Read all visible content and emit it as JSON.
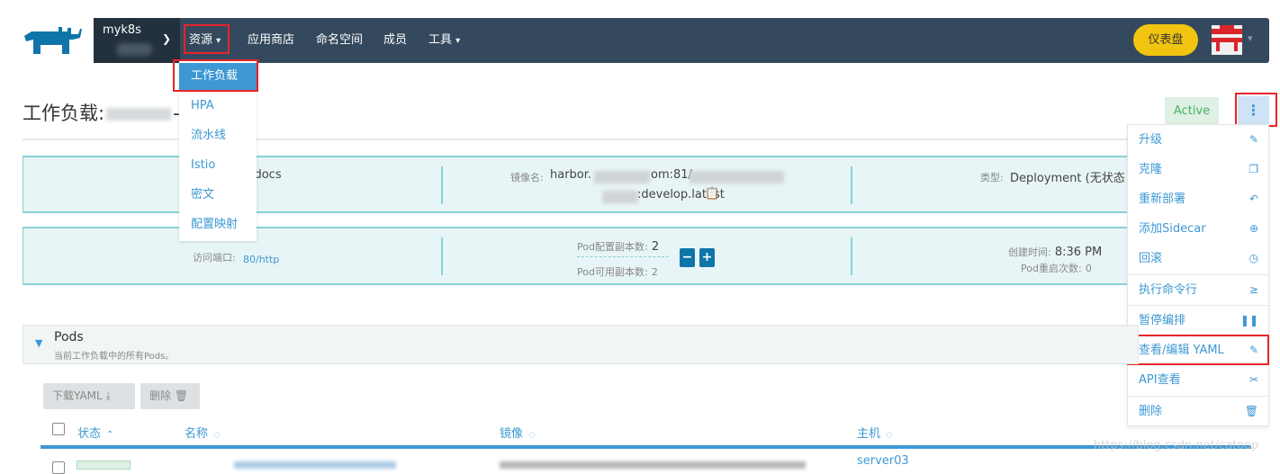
{
  "nav": {
    "cluster": "myk8s",
    "items": [
      {
        "label": "资源",
        "has_chevron": true
      },
      {
        "label": "应用商店"
      },
      {
        "label": "命名空间"
      },
      {
        "label": "成员"
      },
      {
        "label": "工具",
        "has_chevron": true
      }
    ],
    "dashboard_button": "仪表盘"
  },
  "resource_menu": [
    "工作负载",
    "HPA",
    "流水线",
    "Istio",
    "密文",
    "配置映射"
  ],
  "page": {
    "title": "工作负载:",
    "title_suffix": "-d",
    "status": "Active"
  },
  "info1": {
    "name_value": "s-docs",
    "image_label": "镜像名:",
    "image_line1a": "harbor.",
    "image_line1b": "om:81/",
    "image_line2": ":develop.latest",
    "type_label": "类型:",
    "type_value": "Deployment (无状态"
  },
  "info2": {
    "port_label": "访问端口:",
    "port_value": "80/http",
    "config_replicas_label": "Pod配置副本数:",
    "config_replicas": "2",
    "available_replicas_label": "Pod可用副本数:",
    "available_replicas": "2",
    "created_label": "创建时间:",
    "created_value": "8:36 PM",
    "restarts_label": "Pod重启次数:",
    "restarts": "0"
  },
  "actions_menu": [
    {
      "label": "升级",
      "icon": "pencil-icon",
      "glyph": "✎"
    },
    {
      "label": "克隆",
      "icon": "clone-icon",
      "glyph": "❐"
    },
    {
      "label": "重新部署",
      "icon": "redeploy-icon",
      "glyph": "↶"
    },
    {
      "label": "添加Sidecar",
      "icon": "plus-circle-icon",
      "glyph": "⊕"
    },
    {
      "label": "回滚",
      "icon": "history-icon",
      "glyph": "◷"
    },
    {
      "label": "执行命令行",
      "icon": "terminal-icon",
      "glyph": "≥"
    },
    {
      "label": "暂停编排",
      "icon": "pause-icon",
      "glyph": "❚❚"
    },
    {
      "label": "查看/编辑 YAML",
      "icon": "pencil-icon",
      "glyph": "✎"
    },
    {
      "label": "API查看",
      "icon": "api-icon",
      "glyph": "✂"
    },
    {
      "label": "删除",
      "icon": "trash-icon",
      "glyph": "🗑"
    }
  ],
  "pods": {
    "title": "Pods",
    "subtitle": "当前工作负载中的所有Pods。",
    "download_yaml": "下载YAML",
    "delete": "删除",
    "columns": [
      "状态",
      "名称",
      "镜像",
      "主机"
    ],
    "rows": [
      {
        "host": "server03"
      }
    ]
  },
  "watermark": "https://blog.csdn.net/catoop",
  "colors": {
    "nav": "#35495e",
    "accent": "#3d98d3",
    "dashboard": "#f1c40f",
    "highlight": "#e8242a",
    "active": "#48b063"
  }
}
